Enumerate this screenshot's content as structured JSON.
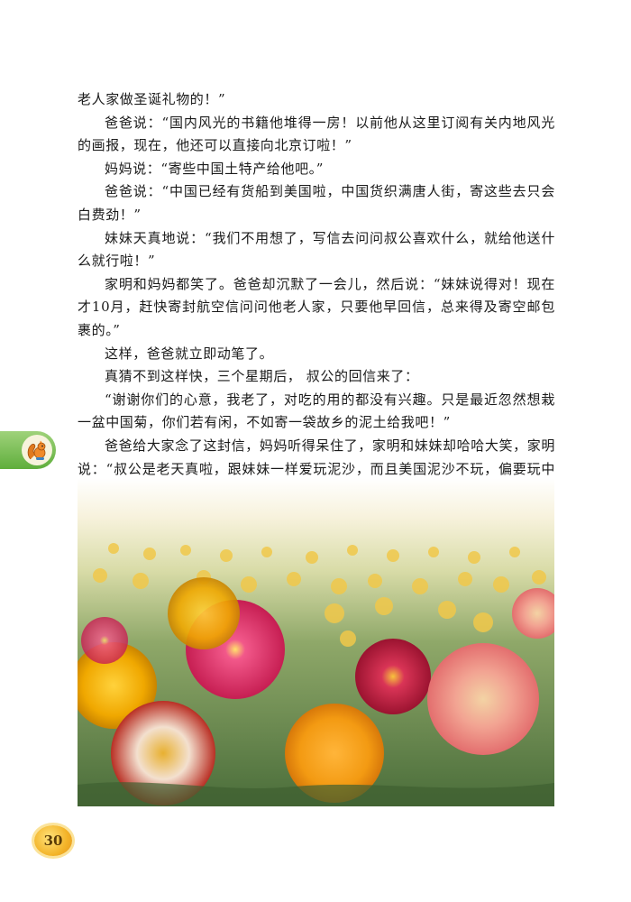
{
  "paragraphs": [
    "老人家做圣诞礼物的！”",
    "爸爸说：“国内风光的书籍他堆得一房！以前他从这里订阅有关内地风光的画报，现在，他还可以直接向北京订啦！”",
    "妈妈说：“寄些中国土特产给他吧。”",
    "爸爸说：“中国已经有货船到美国啦，中国货织满唐人街，寄这些去只会白费劲！”",
    "妹妹天真地说：“我们不用想了，写信去问问叔公喜欢什么，就给他送什么就行啦！”",
    "家明和妈妈都笑了。爸爸却沉默了一会儿，然后说：“妹妹说得对！现在才10月，赶快寄封航空信问问他老人家，只要他早回信，总来得及寄空邮包裹的。”",
    "这样，爸爸就立即动笔了。",
    "真猜不到这样快，三个星期后， 叔公的回信来了：",
    "“谢谢你们的心意，我老了，对吃的用的都没有兴趣。只是最近忽然想栽一盆中国菊，你们若有闲，不如寄一袋故乡的泥土给我吧！”",
    "爸爸给大家念了这封信，妈妈听得呆住了，家明和妹妹却哈哈大笑，家明说：“叔公是老天真啦，跟妹妹一样爱玩泥沙，而且美国泥沙不玩，偏要玩中国泥沙。”"
  ],
  "page_number": "30",
  "icons": {
    "side_tab": "squirrel-icon",
    "photo": "chrysanthemum-field-photo"
  },
  "colors": {
    "tab_green": "#6cb847",
    "badge_gold": "#f3b429"
  }
}
